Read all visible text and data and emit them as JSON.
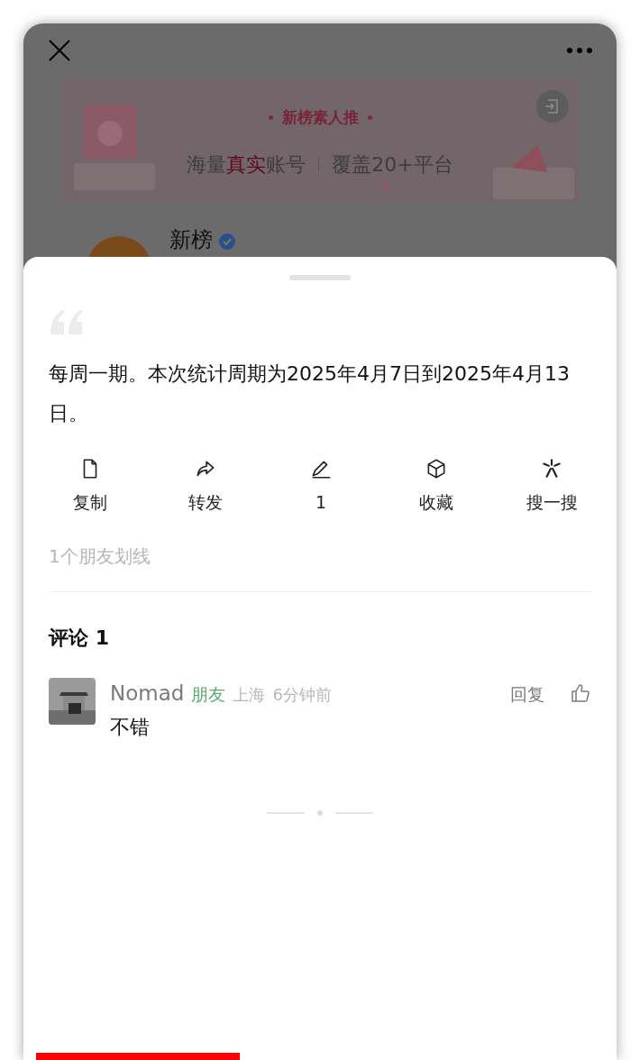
{
  "background_page": {
    "banner": {
      "title": "新榜素人推",
      "subtitle": "海量**真实**账号",
      "subtitle_2": "覆盖20+平台"
    },
    "account_name": "新榜"
  },
  "sheet": {
    "quote": "每周一期。本次统计周期为2025年4月7日到2025年4月13日。",
    "actions": [
      {
        "kind": "copy",
        "label": "复制"
      },
      {
        "kind": "forward",
        "label": "转发"
      },
      {
        "kind": "underline",
        "label": "1"
      },
      {
        "kind": "collect",
        "label": "收藏"
      },
      {
        "kind": "search",
        "label": "搜一搜"
      }
    ],
    "highlight_note": "1个朋友划线",
    "comments_title": "评论 1",
    "comments": [
      {
        "author": "Nomad",
        "tag": "朋友",
        "location": "上海",
        "time": "6分钟前",
        "text": "不错",
        "reply": "回复"
      }
    ]
  }
}
